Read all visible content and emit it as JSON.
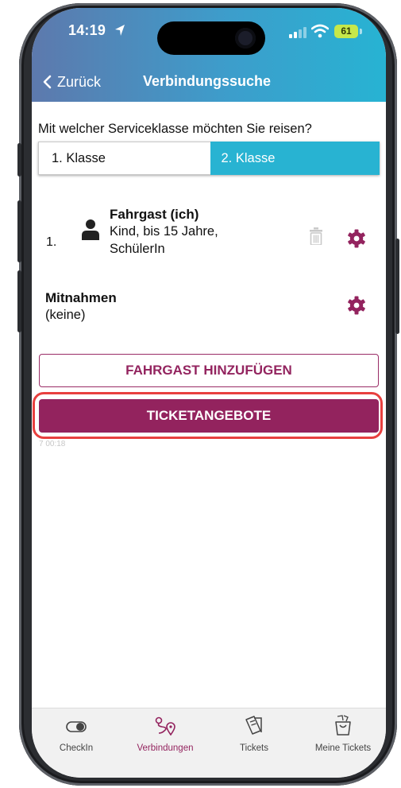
{
  "status_bar": {
    "time": "14:19",
    "battery": "61"
  },
  "nav": {
    "back_label": "Zurück",
    "title": "Verbindungssuche"
  },
  "service_class": {
    "question": "Mit welcher Serviceklasse möchten Sie reisen?",
    "options": [
      "1. Klasse",
      "2. Klasse"
    ],
    "selected": "2. Klasse"
  },
  "passenger": {
    "number": "1.",
    "name": "Fahrgast (ich)",
    "type_line1": "Kind, bis 15 Jahre,",
    "type_line2": "SchülerIn"
  },
  "mitnahmen": {
    "title": "Mitnahmen",
    "value": "(keine)"
  },
  "buttons": {
    "add_passenger": "FAHRGAST HINZUFÜGEN",
    "ticket_offers": "TICKETANGEBOTE"
  },
  "faded_time": "7 00:18",
  "tabbar": {
    "active": "Verbindungen",
    "tabs": [
      {
        "label": "CheckIn",
        "icon": "toggle-icon"
      },
      {
        "label": "Verbindungen",
        "icon": "route-icon"
      },
      {
        "label": "Tickets",
        "icon": "tickets-icon"
      },
      {
        "label": "Meine Tickets",
        "icon": "my-tickets-icon"
      }
    ]
  },
  "colors": {
    "accent": "#93235e",
    "selected_segment": "#28b3d2",
    "highlight": "#e8403f"
  }
}
